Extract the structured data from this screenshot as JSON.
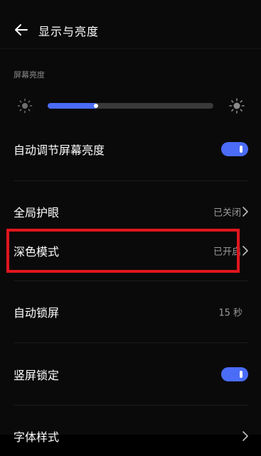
{
  "header": {
    "title": "显示与亮度"
  },
  "brightness": {
    "section_label": "屏幕亮度",
    "level_percent": 30,
    "accent_color": "#4a6cf7"
  },
  "rows": {
    "auto_brightness": {
      "label": "自动调节屏幕亮度",
      "toggle_on": true
    },
    "eye_care": {
      "label": "全局护眼",
      "value": "已关闭"
    },
    "dark_mode": {
      "label": "深色模式",
      "value": "已开启",
      "highlighted": true,
      "highlight_color": "#e0161e"
    },
    "auto_lock": {
      "label": "自动锁屏",
      "value": "15 秒"
    },
    "portrait_lock": {
      "label": "竖屏锁定",
      "toggle_on": true
    },
    "font_style": {
      "label": "字体样式"
    }
  },
  "icons": {
    "back": "back-arrow-icon",
    "sun": "sun-icon",
    "chevron": "chevron-right-icon"
  }
}
